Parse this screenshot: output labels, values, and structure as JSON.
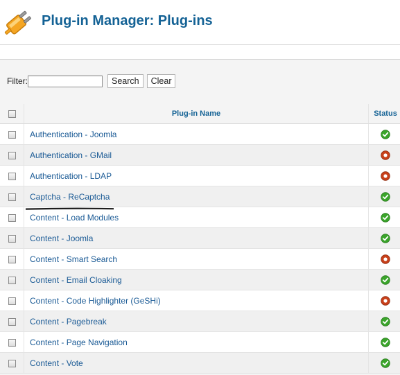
{
  "header": {
    "title": "Plug-in Manager: Plug-ins",
    "logo_icon": "plug-icon",
    "logo_color": "#f5a623"
  },
  "filter": {
    "label": "Filter:",
    "value": "",
    "search_label": "Search",
    "clear_label": "Clear"
  },
  "table": {
    "columns": {
      "name": "Plug-in Name",
      "status": "Status"
    },
    "rows": [
      {
        "name": "Authentication - Joomla",
        "status": "enabled"
      },
      {
        "name": "Authentication - GMail",
        "status": "disabled"
      },
      {
        "name": "Authentication - LDAP",
        "status": "disabled"
      },
      {
        "name": "Captcha - ReCaptcha",
        "status": "enabled"
      },
      {
        "name": "Content - Load Modules",
        "status": "enabled"
      },
      {
        "name": "Content - Joomla",
        "status": "enabled"
      },
      {
        "name": "Content - Smart Search",
        "status": "disabled"
      },
      {
        "name": "Content - Email Cloaking",
        "status": "enabled"
      },
      {
        "name": "Content - Code Highlighter (GeSHi)",
        "status": "disabled"
      },
      {
        "name": "Content - Pagebreak",
        "status": "enabled"
      },
      {
        "name": "Content - Page Navigation",
        "status": "enabled"
      },
      {
        "name": "Content - Vote",
        "status": "enabled"
      }
    ],
    "highlighted_row": "Captcha - ReCaptcha"
  },
  "colors": {
    "title": "#146295",
    "link": "#1a5a95",
    "enabled": "#3aa52a",
    "disabled": "#c8401a"
  }
}
